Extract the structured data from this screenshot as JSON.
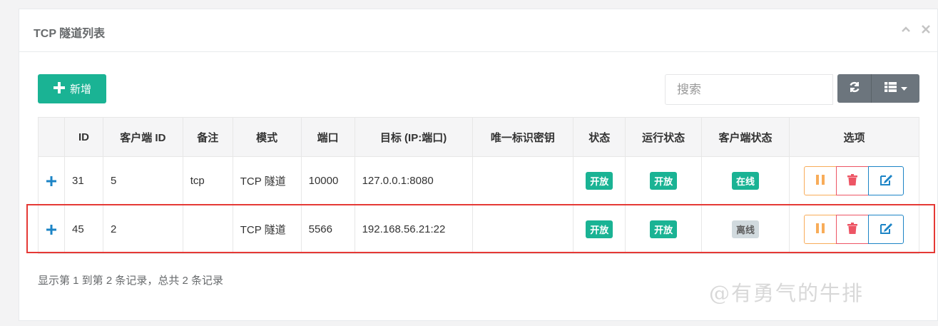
{
  "panel": {
    "title": "TCP 隧道列表"
  },
  "toolbar": {
    "add_label": "新增",
    "search_placeholder": "搜索"
  },
  "table": {
    "headers": [
      "",
      "ID",
      "客户端 ID",
      "备注",
      "模式",
      "端口",
      "目标 (IP:端口)",
      "唯一标识密钥",
      "状态",
      "运行状态",
      "客户端状态",
      "选项"
    ],
    "rows": [
      {
        "id": "31",
        "client_id": "5",
        "remark": "tcp",
        "mode": "TCP 隧道",
        "port": "10000",
        "target": "127.0.0.1:8080",
        "key": "",
        "status": "开放",
        "run_status": "开放",
        "client_status": "在线",
        "client_online": true
      },
      {
        "id": "45",
        "client_id": "2",
        "remark": "",
        "mode": "TCP 隧道",
        "port": "5566",
        "target": "192.168.56.21:22",
        "key": "",
        "status": "开放",
        "run_status": "开放",
        "client_status": "离线",
        "client_online": false
      }
    ]
  },
  "footer": {
    "summary": "显示第 1 到第 2 条记录，总共 2 条记录"
  },
  "watermark": "@有勇气的牛排",
  "colors": {
    "primary": "#1ab394",
    "warning": "#f8ac59",
    "danger": "#ed5565",
    "info": "#1c84c6",
    "highlight": "#e53935"
  }
}
